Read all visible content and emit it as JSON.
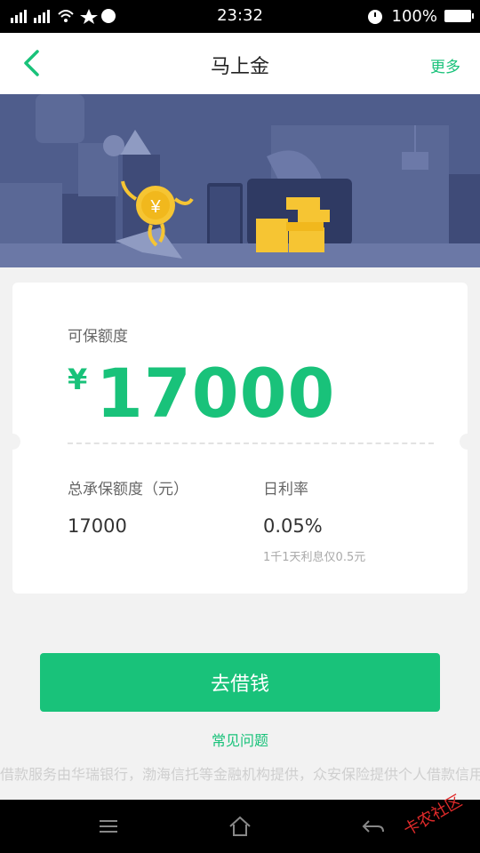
{
  "status_bar": {
    "time": "23:32",
    "battery": "100%"
  },
  "nav": {
    "title": "马上金",
    "more": "更多"
  },
  "card": {
    "label": "可保额度",
    "currency_symbol": "¥",
    "amount": "17000",
    "total_label": "总承保额度（元）",
    "total_value": "17000",
    "rate_label": "日利率",
    "rate_value": "0.05%",
    "rate_note": "1千1天利息仅0.5元"
  },
  "cta_label": "去借钱",
  "faq_label": "常见问题",
  "footer_text": "借款服务由华瑞银行，渤海信托等金融机构提供，众安保险提供个人借款信用保险服务",
  "watermark": "卡农社区",
  "colors": {
    "accent": "#19c27a",
    "banner": "#4d5b8a"
  }
}
